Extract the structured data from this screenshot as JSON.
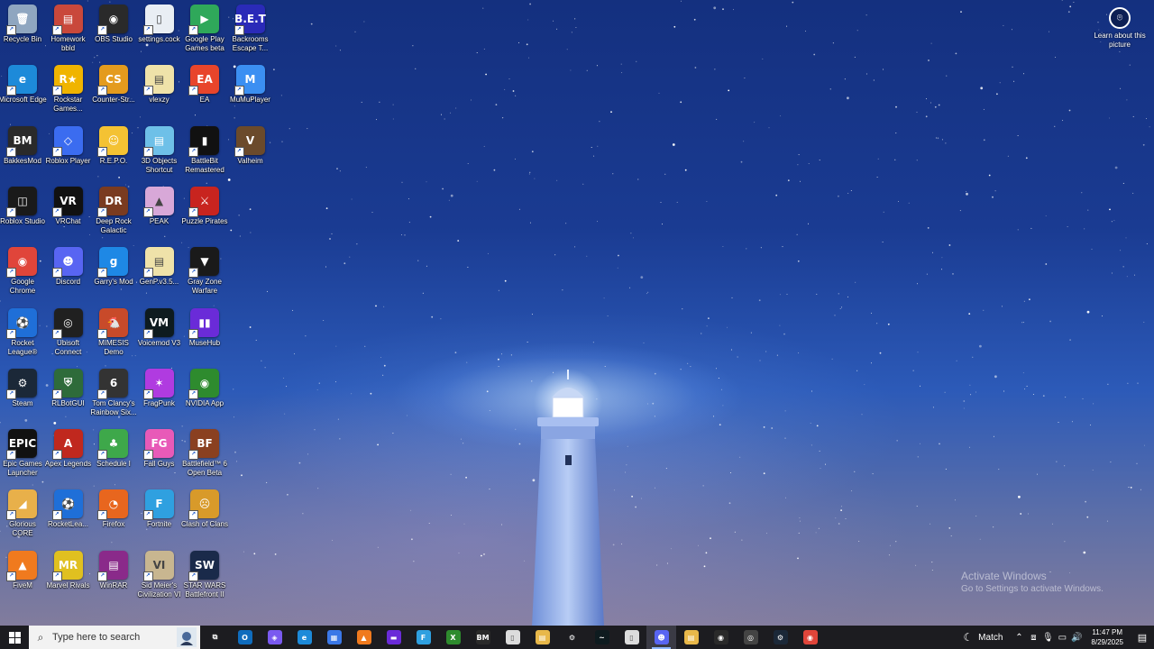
{
  "desktop": {
    "icons": [
      {
        "label": "Recycle Bin",
        "glyph": "🗑",
        "color": "#8fa6c0",
        "col": 0,
        "row": 0
      },
      {
        "label": "Homework bbld",
        "glyph": "▤",
        "color": "#c9483b",
        "col": 1,
        "row": 0
      },
      {
        "label": "OBS Studio",
        "glyph": "◉",
        "color": "#2a2a2a",
        "col": 2,
        "row": 0
      },
      {
        "label": "settings.cock",
        "glyph": "▯",
        "color": "#e9eef4",
        "col": 3,
        "row": 0
      },
      {
        "label": "Google Play Games beta",
        "glyph": "▶",
        "color": "#2fa85a",
        "col": 4,
        "row": 0
      },
      {
        "label": "Backrooms Escape T...",
        "glyph": "B.E.T",
        "color": "#2a2ab8",
        "col": 5,
        "row": 0
      },
      {
        "label": "Microsoft Edge",
        "glyph": "e",
        "color": "#1d8ad9",
        "col": 0,
        "row": 1
      },
      {
        "label": "Rockstar Games...",
        "glyph": "R★",
        "color": "#f0b400",
        "col": 1,
        "row": 1
      },
      {
        "label": "Counter-Str...",
        "glyph": "CS",
        "color": "#e49b1e",
        "col": 2,
        "row": 1
      },
      {
        "label": "vlexzy",
        "glyph": "▤",
        "color": "#efe2a9",
        "col": 3,
        "row": 1
      },
      {
        "label": "EA",
        "glyph": "EA",
        "color": "#e8452b",
        "col": 4,
        "row": 1
      },
      {
        "label": "MuMuPlayer",
        "glyph": "M",
        "color": "#3b8ff2",
        "col": 5,
        "row": 1
      },
      {
        "label": "BakkesMod",
        "glyph": "BM",
        "color": "#2a2a2a",
        "col": 0,
        "row": 2
      },
      {
        "label": "Roblox Player",
        "glyph": "◇",
        "color": "#3b6cf0",
        "col": 1,
        "row": 2
      },
      {
        "label": "R.E.P.O.",
        "glyph": "☺",
        "color": "#f4c233",
        "col": 2,
        "row": 2
      },
      {
        "label": "3D Objects Shortcut",
        "glyph": "▤",
        "color": "#6ec0e8",
        "col": 3,
        "row": 2
      },
      {
        "label": "BattleBit Remastered",
        "glyph": "▮",
        "color": "#111111",
        "col": 4,
        "row": 2
      },
      {
        "label": "Valheim",
        "glyph": "V",
        "color": "#6b4a2b",
        "col": 5,
        "row": 2
      },
      {
        "label": "Roblox Studio",
        "glyph": "◫",
        "color": "#1a1a1a",
        "col": 0,
        "row": 3
      },
      {
        "label": "VRChat",
        "glyph": "VR",
        "color": "#111111",
        "col": 1,
        "row": 3
      },
      {
        "label": "Deep Rock Galactic",
        "glyph": "DR",
        "color": "#7a3b20",
        "col": 2,
        "row": 3
      },
      {
        "label": "PEAK",
        "glyph": "▲",
        "color": "#d8a8d8",
        "col": 3,
        "row": 3
      },
      {
        "label": "Puzzle Pirates",
        "glyph": "⚔",
        "color": "#c8241f",
        "col": 4,
        "row": 3
      },
      {
        "label": "Google Chrome",
        "glyph": "◉",
        "color": "#e0453a",
        "col": 0,
        "row": 4
      },
      {
        "label": "Discord",
        "glyph": "☻",
        "color": "#5865f2",
        "col": 1,
        "row": 4
      },
      {
        "label": "Garry's Mod",
        "glyph": "g",
        "color": "#1e88e5",
        "col": 2,
        "row": 4
      },
      {
        "label": "GenP.v3.5...",
        "glyph": "▤",
        "color": "#efe2a9",
        "col": 3,
        "row": 4
      },
      {
        "label": "Gray Zone Warfare",
        "glyph": "▼",
        "color": "#1a1a1a",
        "col": 4,
        "row": 4
      },
      {
        "label": "Rocket League®",
        "glyph": "⚽",
        "color": "#1f6fd8",
        "col": 0,
        "row": 5
      },
      {
        "label": "Ubisoft Connect",
        "glyph": "◎",
        "color": "#202020",
        "col": 1,
        "row": 5
      },
      {
        "label": "MIMESIS Demo",
        "glyph": "🐔",
        "color": "#c84a2a",
        "col": 2,
        "row": 5
      },
      {
        "label": "Voicemod V3",
        "glyph": "VM",
        "color": "#0e1b1f",
        "col": 3,
        "row": 5
      },
      {
        "label": "MuseHub",
        "glyph": "▮▮",
        "color": "#6a2bd8",
        "col": 4,
        "row": 5
      },
      {
        "label": "Steam",
        "glyph": "⚙",
        "color": "#1b2838",
        "col": 0,
        "row": 6
      },
      {
        "label": "RLBotGUI",
        "glyph": "⛨",
        "color": "#2e6b3a",
        "col": 1,
        "row": 6
      },
      {
        "label": "Tom Clancy's Rainbow Six...",
        "glyph": "6",
        "color": "#333333",
        "col": 2,
        "row": 6
      },
      {
        "label": "FragPunk",
        "glyph": "✶",
        "color": "#b03be0",
        "col": 3,
        "row": 6
      },
      {
        "label": "NVIDIA App",
        "glyph": "◉",
        "color": "#2e8b2e",
        "col": 4,
        "row": 6
      },
      {
        "label": "Epic Games Launcher",
        "glyph": "EPIC",
        "color": "#111111",
        "col": 0,
        "row": 7
      },
      {
        "label": "Apex Legends",
        "glyph": "A",
        "color": "#c0281e",
        "col": 1,
        "row": 7
      },
      {
        "label": "Schedule I",
        "glyph": "♣",
        "color": "#3ea84a",
        "col": 2,
        "row": 7
      },
      {
        "label": "Fall Guys",
        "glyph": "FG",
        "color": "#e85ab8",
        "col": 3,
        "row": 7
      },
      {
        "label": "Battlefield™ 6 Open Beta",
        "glyph": "BF",
        "color": "#8a4020",
        "col": 4,
        "row": 7
      },
      {
        "label": "Glorious CORE",
        "glyph": "◢",
        "color": "#e8b04a",
        "col": 0,
        "row": 8
      },
      {
        "label": "RocketLea...",
        "glyph": "⚽",
        "color": "#1f6fd8",
        "col": 1,
        "row": 8
      },
      {
        "label": "Firefox",
        "glyph": "◔",
        "color": "#e8661e",
        "col": 2,
        "row": 8
      },
      {
        "label": "Fortnite",
        "glyph": "F",
        "color": "#2fa0e0",
        "col": 3,
        "row": 8
      },
      {
        "label": "Clash of Clans",
        "glyph": "☹",
        "color": "#d89a2a",
        "col": 4,
        "row": 8
      },
      {
        "label": "FiveM",
        "glyph": "▲",
        "color": "#f07a1e",
        "col": 0,
        "row": 9
      },
      {
        "label": "Marvel Rivals",
        "glyph": "MR",
        "color": "#e0c020",
        "col": 1,
        "row": 9
      },
      {
        "label": "WinRAR",
        "glyph": "▤",
        "color": "#8a2a8a",
        "col": 2,
        "row": 9
      },
      {
        "label": "Sid Meier's Civilization VI",
        "glyph": "VI",
        "color": "#c8b690",
        "col": 3,
        "row": 9
      },
      {
        "label": "STAR WARS Battlefront II",
        "glyph": "SW",
        "color": "#1a2a4a",
        "col": 4,
        "row": 9
      }
    ]
  },
  "learn": {
    "label": "Learn about this picture",
    "icon": "camera-icon"
  },
  "activate": {
    "title": "Activate Windows",
    "subtitle": "Go to Settings to activate Windows."
  },
  "taskbar": {
    "search_placeholder": "Type here to search",
    "apps": [
      {
        "name": "task-view",
        "glyph": "⧉",
        "color": "transparent"
      },
      {
        "name": "outlook",
        "glyph": "O",
        "color": "#0f6cbd"
      },
      {
        "name": "copilot",
        "glyph": "◈",
        "color": "#7a5af0"
      },
      {
        "name": "edge",
        "glyph": "e",
        "color": "#1d8ad9"
      },
      {
        "name": "store",
        "glyph": "▦",
        "color": "#3b78e7"
      },
      {
        "name": "fivem",
        "glyph": "▲",
        "color": "#f07a1e"
      },
      {
        "name": "app-purple",
        "glyph": "▬",
        "color": "#6a2bd8"
      },
      {
        "name": "fortnite",
        "glyph": "F",
        "color": "#2fa0e0"
      },
      {
        "name": "xbox",
        "glyph": "X",
        "color": "#2e8b2e"
      },
      {
        "name": "bakkesmod",
        "glyph": "BM",
        "color": "#2a2a2a"
      },
      {
        "name": "file",
        "glyph": "▯",
        "color": "#dcdcdc"
      },
      {
        "name": "folder-yellow",
        "glyph": "▤",
        "color": "#e8b84a"
      },
      {
        "name": "steam-settings",
        "glyph": "⚙",
        "color": "transparent"
      },
      {
        "name": "voicemod",
        "glyph": "~",
        "color": "#0e1b1f"
      },
      {
        "name": "document",
        "glyph": "▯",
        "color": "#dcdcdc"
      },
      {
        "name": "discord",
        "glyph": "☻",
        "color": "#5865f2",
        "active": true
      },
      {
        "name": "file-explorer",
        "glyph": "▤",
        "color": "#e8b84a"
      },
      {
        "name": "obs",
        "glyph": "◉",
        "color": "#2a2a2a"
      },
      {
        "name": "app-circle",
        "glyph": "◎",
        "color": "#444444"
      },
      {
        "name": "steam",
        "glyph": "⚙",
        "color": "#1b2838"
      },
      {
        "name": "chrome",
        "glyph": "◉",
        "color": "#e0453a"
      }
    ],
    "weather": "Match",
    "time": "11:47 PM",
    "date": "8/29/2025"
  }
}
